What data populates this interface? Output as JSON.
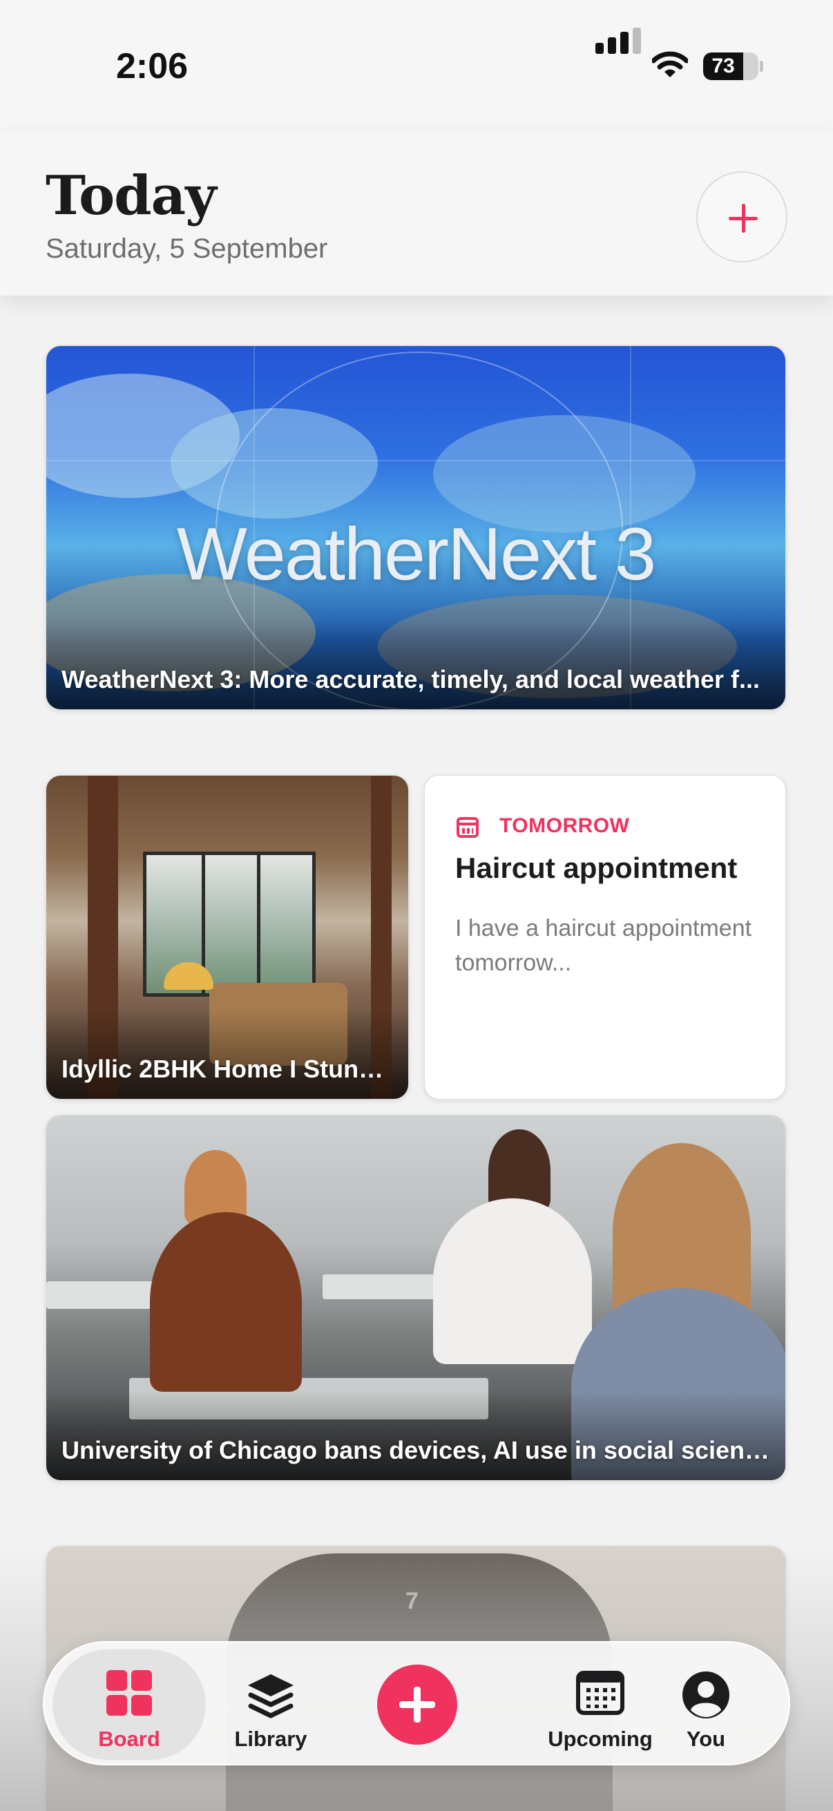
{
  "status_bar": {
    "time": "2:06",
    "battery": "73"
  },
  "header": {
    "title": "Today",
    "date": "Saturday, 5 September"
  },
  "feed": {
    "weather_card": {
      "logo_text": "WeatherNext 3",
      "caption": "WeatherNext 3: More accurate, timely, and local weather f..."
    },
    "home_card": {
      "caption": "Idyllic 2BHK Home I Stunni..."
    },
    "reminder_card": {
      "tag": "TOMORROW",
      "title": "Haircut appointment",
      "body": "I have a haircut appointment tomorrow..."
    },
    "classroom_card": {
      "caption": "University of Chicago bans devices, AI use in social scienc..."
    }
  },
  "tab_bar": {
    "board": "Board",
    "library": "Library",
    "upcoming": "Upcoming",
    "you": "You"
  },
  "colors": {
    "accent": "#f0325f",
    "background": "#f2f2f3"
  },
  "icons": [
    "cellular-signal-icon",
    "wifi-icon",
    "battery-icon",
    "plus-icon",
    "calendar-icon",
    "board-grid-icon",
    "layers-icon",
    "calendar-grid-icon",
    "person-icon"
  ]
}
